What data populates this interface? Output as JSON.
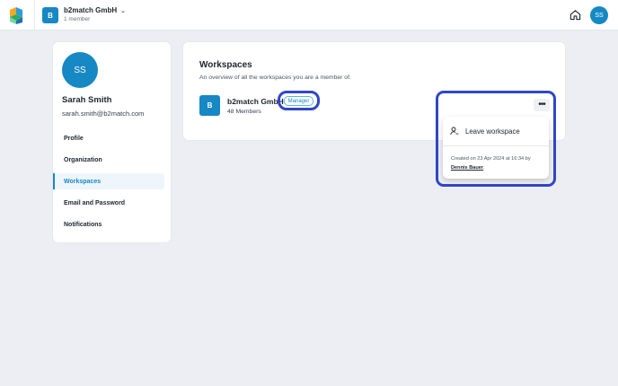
{
  "topbar": {
    "org_initial": "B",
    "org_name": "b2match GmbH",
    "org_members": "1 member",
    "user_initials": "SS"
  },
  "profile": {
    "initials": "SS",
    "name": "Sarah Smith",
    "email": "sarah.smith@b2match.com",
    "nav": [
      {
        "label": "Profile",
        "active": false
      },
      {
        "label": "Organization",
        "active": false
      },
      {
        "label": "Workspaces",
        "active": true
      },
      {
        "label": "Email and Password",
        "active": false
      },
      {
        "label": "Notifications",
        "active": false
      }
    ]
  },
  "workspaces": {
    "title": "Workspaces",
    "subtitle": "An overview of all the workspaces you are a member of.",
    "items": [
      {
        "initial": "B",
        "name": "b2match GmbH",
        "members": "48 Members",
        "role": "Manager"
      }
    ]
  },
  "menu": {
    "more_icon": "ellipsis-icon",
    "leave_label": "Leave workspace",
    "created_prefix": "Created on 23 Apr 2024 at 16:34 by",
    "created_by": "Dennis Bauer",
    "created_suffix": "."
  },
  "colors": {
    "brand": "#1688c4",
    "highlight": "#2f47c6",
    "background": "#eceef3"
  }
}
